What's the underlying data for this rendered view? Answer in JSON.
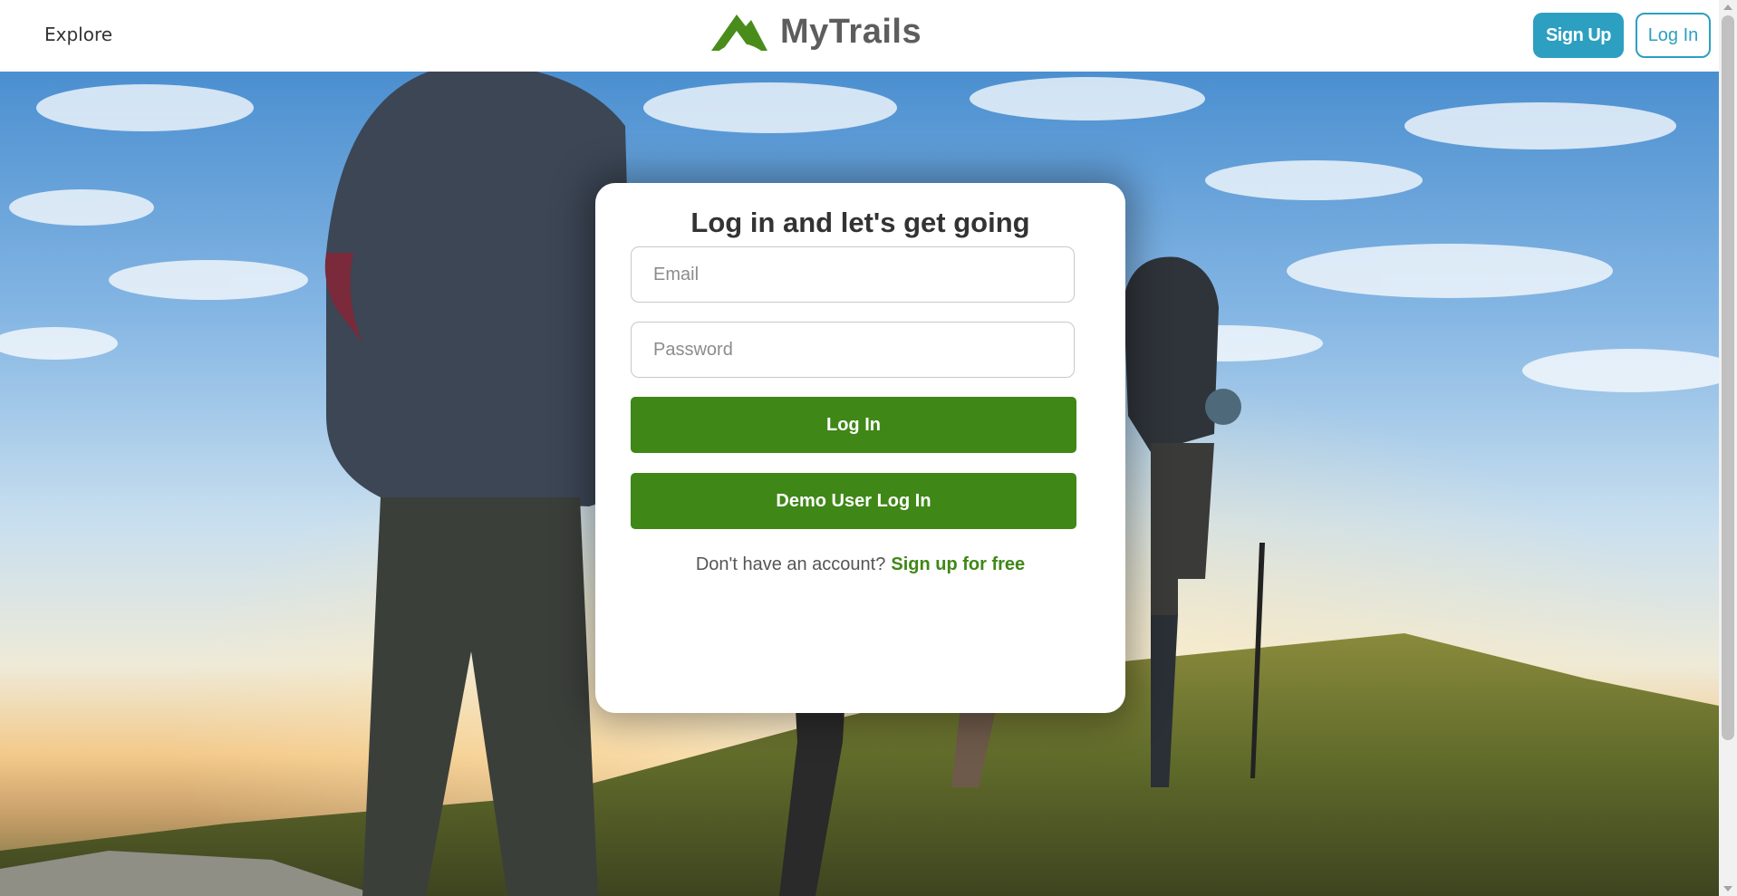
{
  "header": {
    "explore_label": "Explore",
    "brand_name": "MyTrails",
    "signup_label": "Sign Up",
    "login_label": "Log In"
  },
  "login_card": {
    "title": "Log in and let's get going",
    "email_placeholder": "Email",
    "password_placeholder": "Password",
    "login_button_label": "Log In",
    "demo_button_label": "Demo User Log In",
    "no_account_text": "Don't have an account?",
    "signup_link_label": "Sign up for free"
  },
  "colors": {
    "brand_green": "#3f8717",
    "accent_blue": "#2d9fc0",
    "logo_green": "#4a8c1c",
    "brand_text_gray": "#5d5d5d"
  },
  "icons": {
    "logo": "mountain-logo-icon"
  }
}
